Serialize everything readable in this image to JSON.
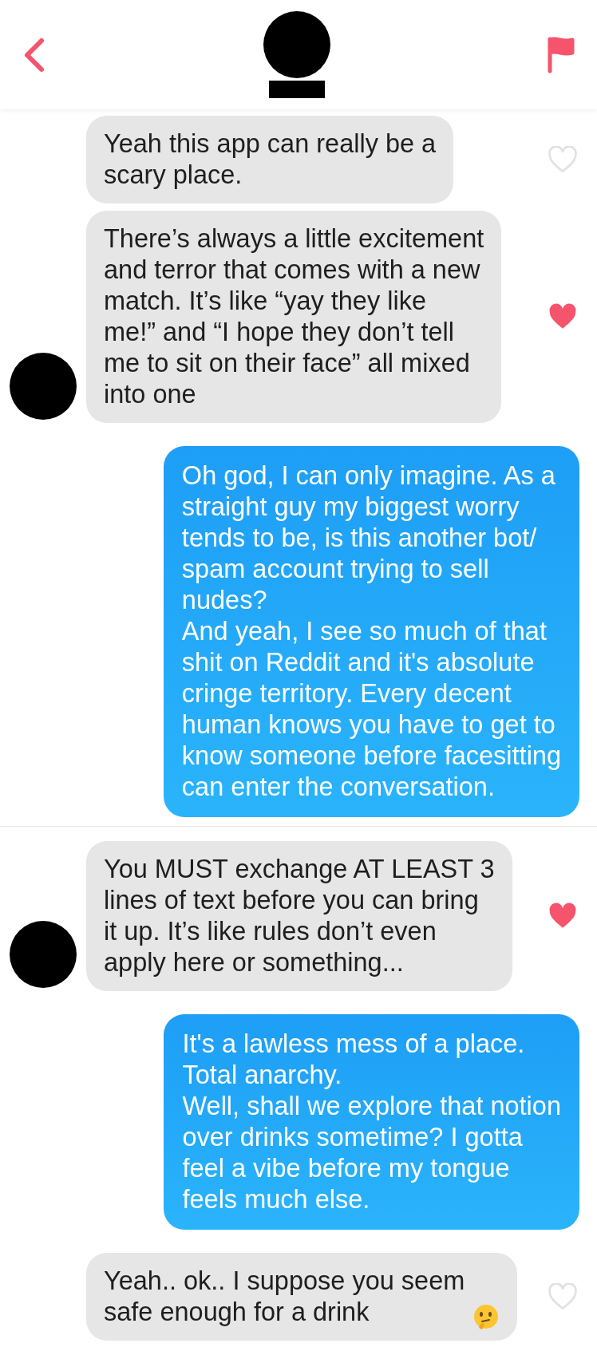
{
  "messages": [
    {
      "kind": "received",
      "lines": [
        "Yeah this app can really be a",
        "scary place."
      ],
      "liked": false,
      "show_avatar": false,
      "separator_above": false,
      "has_emoji": false
    },
    {
      "kind": "received",
      "lines": [
        "There’s always a little excitement",
        "and terror that comes with a new",
        "match. It’s like “yay they like",
        "me!” and “I hope they don’t tell",
        "me to sit on their face” all mixed",
        "into one"
      ],
      "liked": true,
      "show_avatar": true,
      "separator_above": false,
      "has_emoji": false
    },
    {
      "kind": "sent",
      "lines": [
        "Oh god, I can only imagine. As a",
        "straight guy my biggest worry",
        "tends to be, is this another bot/",
        "spam account trying to sell",
        "nudes?",
        "And yeah, I see so much of that",
        "shit on Reddit and it's absolute",
        "cringe territory. Every decent",
        "human knows you have to get to",
        "know someone before facesitting",
        "can enter the conversation."
      ],
      "separator_above": false,
      "has_emoji": false
    },
    {
      "kind": "received",
      "lines": [
        "You MUST exchange AT LEAST 3",
        "lines of text before you can bring",
        "it up. It’s like rules don’t even",
        "apply here or something..."
      ],
      "liked": true,
      "show_avatar": true,
      "separator_above": true,
      "has_emoji": false
    },
    {
      "kind": "sent",
      "lines": [
        "It's a lawless mess of a place.",
        "Total anarchy.",
        "Well, shall we explore that notion",
        "over drinks sometime? I gotta",
        "feel a vibe before my tongue",
        "feels much else."
      ],
      "separator_above": false,
      "has_emoji": false
    },
    {
      "kind": "received",
      "lines": [
        "Yeah.. ok.. I suppose you seem",
        "safe enough for a drink"
      ],
      "liked": false,
      "show_avatar": false,
      "separator_above": false,
      "has_emoji": true
    }
  ]
}
